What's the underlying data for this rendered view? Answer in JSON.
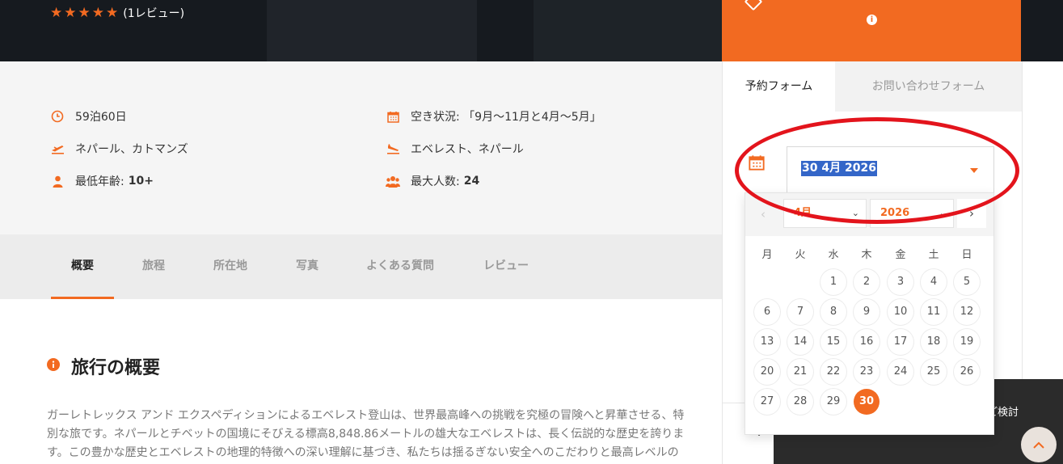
{
  "hero": {
    "rating_stars": 5,
    "review_count": "(1レビュー)"
  },
  "info": {
    "duration": "59泊60日",
    "availability": "空き状況: 「9月〜11月と4月〜5月」",
    "departure": "ネパール、カトマンズ",
    "destination": "エベレスト、ネパール",
    "min_age_label": "最低年齢:",
    "min_age": "10+",
    "max_people_label": "最大人数:",
    "max_people": "24"
  },
  "tabs": [
    {
      "label": "概要"
    },
    {
      "label": "旅程"
    },
    {
      "label": "所在地"
    },
    {
      "label": "写真"
    },
    {
      "label": "よくある質問"
    },
    {
      "label": "レビュー"
    }
  ],
  "overview": {
    "title": "旅行の概要",
    "text": "ガーレトレックス アンド エクスペディションによるエベレスト登山は、世界最高峰への挑戦を究極の冒険へと昇華させる、特別な旅です。ネパールとチベットの国境にそびえる標高8,848.86メートルの雄大なエベレストは、長く伝説的な歴史を誇ります。この豊かな歴史とエベレストの地理的特徴への深い理解に基づき、私たちは揺るぎない安全へのこだわりと最高レベルの"
  },
  "sidebar": {
    "tab_booking": "予約フォーム",
    "tab_inquiry": "お問い合わせフォーム",
    "selected_date": "30 4月 2026",
    "dark_button_label": "ご検討"
  },
  "datepicker": {
    "month": "4月",
    "year": "2026",
    "weekdays": [
      "月",
      "火",
      "水",
      "木",
      "金",
      "土",
      "日"
    ],
    "selected_day": 30,
    "days_in_month": 30,
    "first_weekday_index": 2
  },
  "colors": {
    "accent": "#f26a21",
    "annotation": "#e3141c",
    "selection": "#3466c8"
  }
}
